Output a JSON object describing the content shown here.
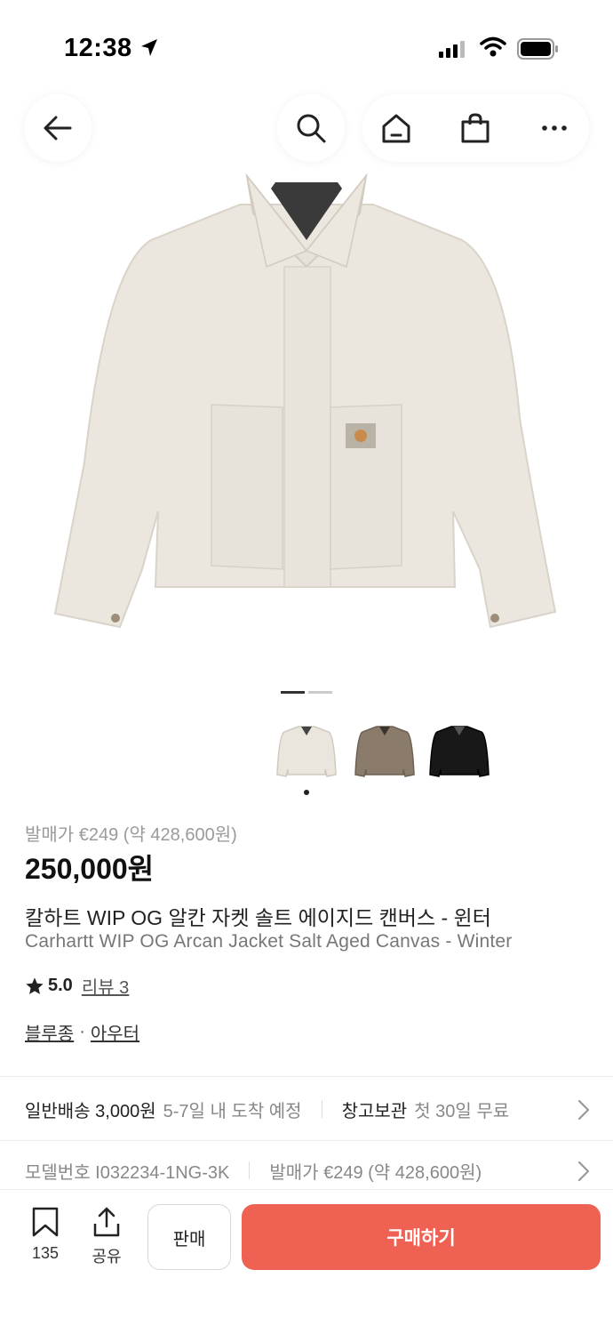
{
  "status_bar": {
    "time": "12:38"
  },
  "product": {
    "release_price": "발매가 €249 (약 428,600원)",
    "price": "250,000원",
    "title_ko": "칼하트 WIP OG 알칸 자켓 솔트 에이지드 캔버스 - 윈터",
    "title_en": "Carhartt WIP OG Arcan Jacket Salt Aged Canvas - Winter",
    "rating": "5.0",
    "review_link": "리뷰 3",
    "category_1": "블루종",
    "category_sep": "·",
    "category_2": "아우터",
    "thumbnails": [
      {
        "name": "salt",
        "color": "#ebe6dd"
      },
      {
        "name": "brown",
        "color": "#8a7b6a"
      },
      {
        "name": "black",
        "color": "#181818"
      }
    ]
  },
  "shipping": {
    "standard_label": "일반배송 3,000원",
    "standard_eta": "5-7일 내 도착 예정",
    "warehouse_label": "창고보관",
    "warehouse_note": "첫 30일 무료"
  },
  "model_info": {
    "model_number": "모델번호 I032234-1NG-3K",
    "release_price": "발매가 €249 (약 428,600원)"
  },
  "bottom_bar": {
    "wish_count": "135",
    "share_label": "공유",
    "sell_label": "판매",
    "buy_label": "구매하기"
  },
  "colors": {
    "accent": "#ef6253"
  }
}
